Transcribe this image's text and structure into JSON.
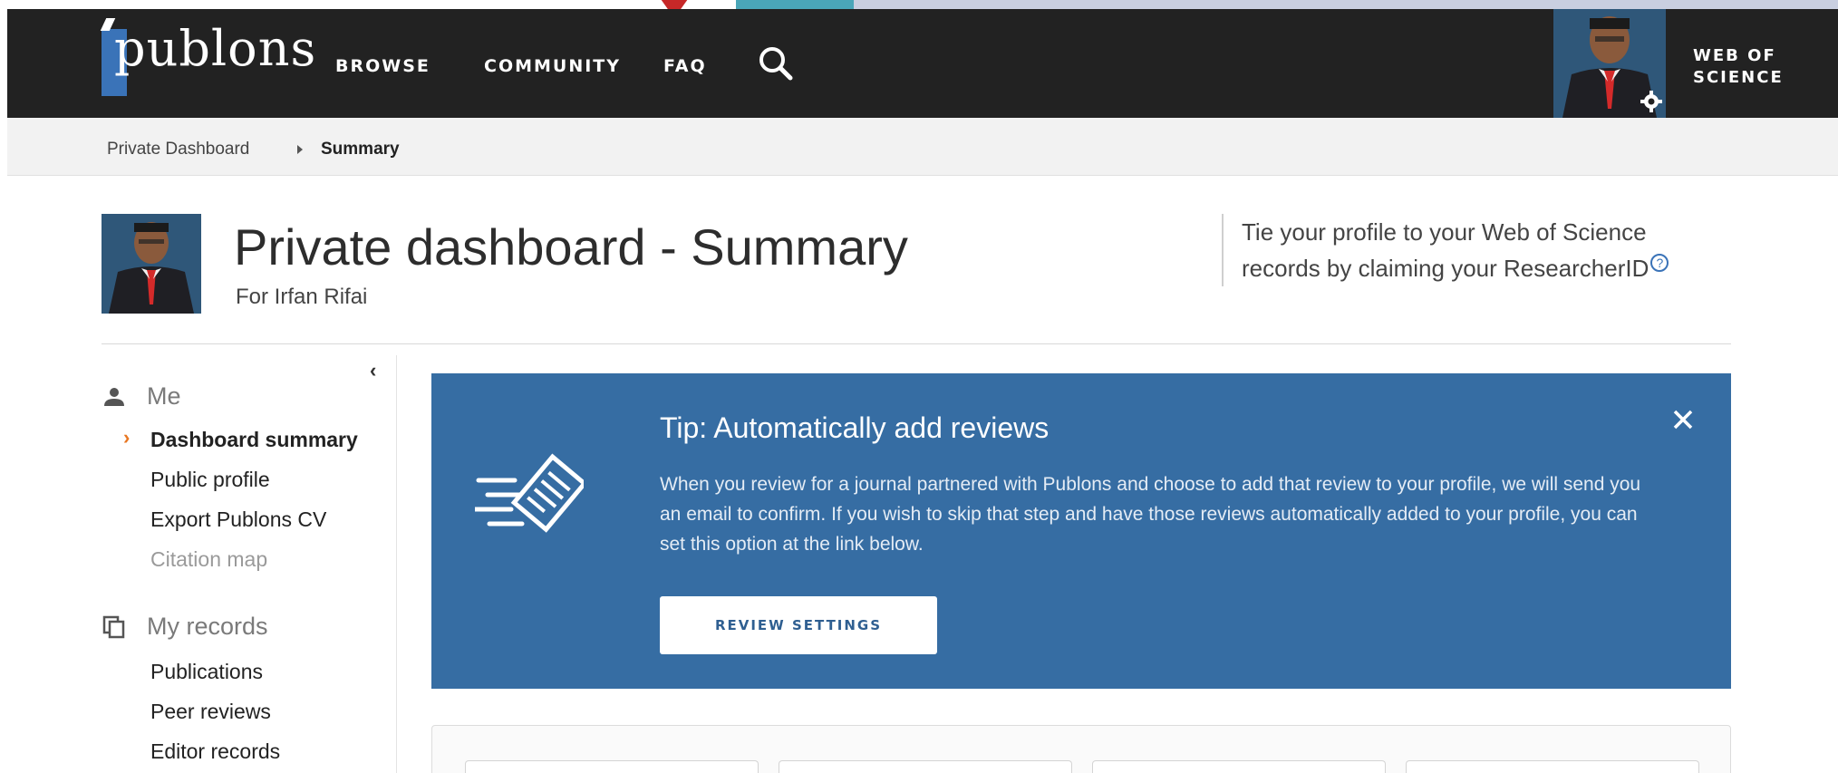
{
  "nav": {
    "logo_text": "publons",
    "links": [
      "BROWSE",
      "COMMUNITY",
      "FAQ"
    ],
    "wos_label": "WEB OF SCIENCE"
  },
  "breadcrumb": {
    "parent": "Private Dashboard",
    "current": "Summary"
  },
  "header": {
    "title": "Private dashboard - Summary",
    "subtitle": "For Irfan Rifai",
    "claim_text": "Tie your profile to your Web of Science records by claiming your ResearcherID"
  },
  "sidebar": {
    "me": {
      "heading": "Me",
      "items": [
        "Dashboard summary",
        "Public profile",
        "Export Publons CV",
        "Citation map"
      ]
    },
    "records": {
      "heading": "My records",
      "items": [
        "Publications",
        "Peer reviews",
        "Editor records"
      ]
    }
  },
  "tip": {
    "title": "Tip:  Automatically add reviews",
    "body": "When you review for a journal partnered with Publons and choose to add that review to your profile, we will send you an email to confirm. If you wish to skip that step and have those reviews automatically added to your profile, you can set this option at the link below.",
    "button_label": "REVIEW SETTINGS"
  },
  "colors": {
    "nav_bg": "#222222",
    "tip_bg": "#366da3",
    "accent_orange": "#e87722",
    "logo_blue": "#3a73b8"
  },
  "icons": [
    "search-icon",
    "gear-icon",
    "help-icon",
    "person-icon",
    "copy-icon",
    "close-icon",
    "chevron-left-icon",
    "chevron-right-icon"
  ]
}
